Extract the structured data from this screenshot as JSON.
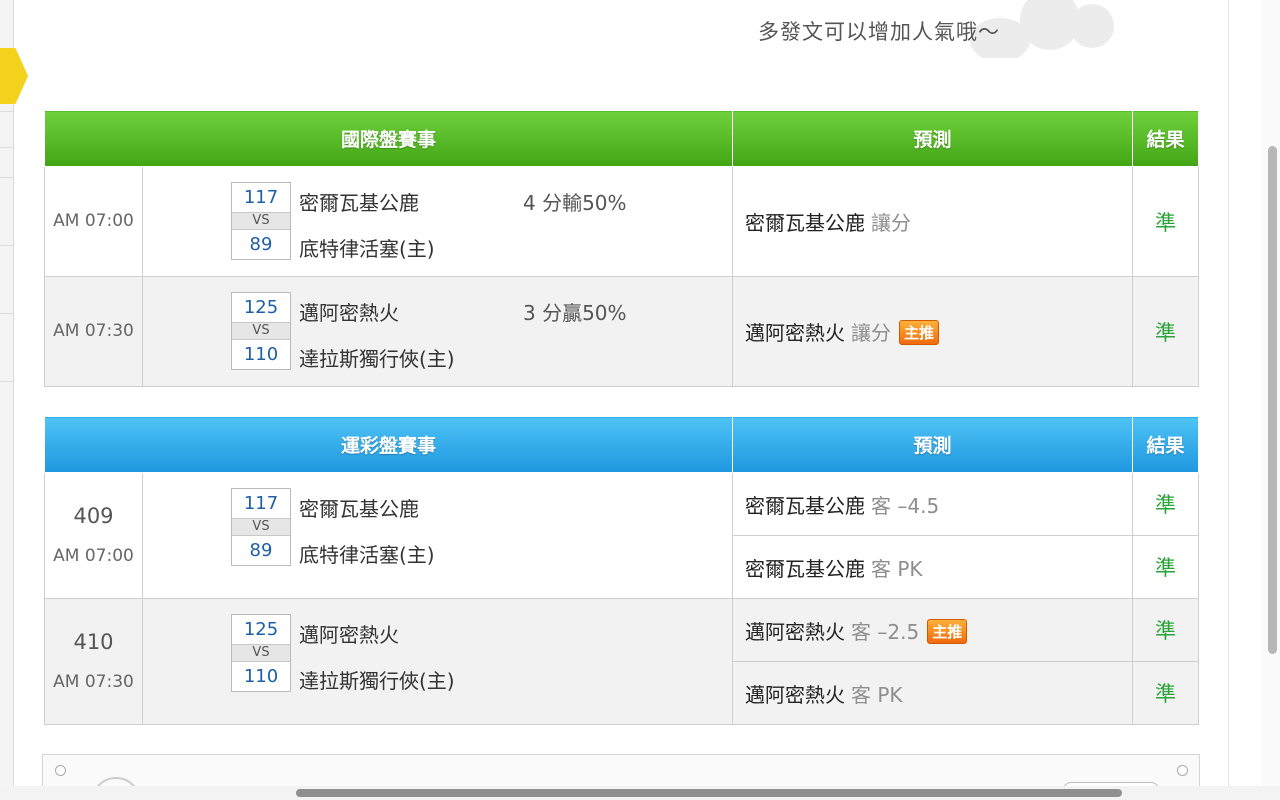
{
  "promo_text": "多發文可以增加人氣哦～",
  "intl": {
    "header": {
      "event": "國際盤賽事",
      "prediction": "預測",
      "result": "結果"
    },
    "rows": [
      {
        "time": "AM 07:00",
        "score_away": "117",
        "vs": "VS",
        "score_home": "89",
        "team_away": "密爾瓦基公鹿",
        "team_home": "底特律活塞(主)",
        "spread": "4 分輸50%",
        "pick_team": "密爾瓦基公鹿",
        "pick_type": "讓分",
        "result": "準"
      },
      {
        "time": "AM 07:30",
        "score_away": "125",
        "vs": "VS",
        "score_home": "110",
        "team_away": "邁阿密熱火",
        "team_home": "達拉斯獨行俠(主)",
        "spread": "3 分贏50%",
        "pick_team": "邁阿密熱火",
        "pick_type": "讓分",
        "badge": "主推",
        "result": "準"
      }
    ]
  },
  "lottery": {
    "header": {
      "event": "運彩盤賽事",
      "prediction": "預測",
      "result": "結果"
    },
    "games": [
      {
        "number": "409",
        "time": "AM 07:00",
        "score_away": "117",
        "vs": "VS",
        "score_home": "89",
        "team_away": "密爾瓦基公鹿",
        "team_home": "底特律活塞(主)",
        "picks": [
          {
            "team": "密爾瓦基公鹿",
            "line": "客 –4.5",
            "result": "準"
          },
          {
            "team": "密爾瓦基公鹿",
            "line": "客 PK",
            "result": "準"
          }
        ]
      },
      {
        "number": "410",
        "time": "AM 07:30",
        "score_away": "125",
        "vs": "VS",
        "score_home": "110",
        "team_away": "邁阿密熱火",
        "team_home": "達拉斯獨行俠(主)",
        "picks": [
          {
            "team": "邁阿密熱火",
            "line": "客 –2.5",
            "badge": "主推",
            "result": "準"
          },
          {
            "team": "邁阿密熱火",
            "line": "客 PK",
            "result": "準"
          }
        ]
      }
    ]
  },
  "colors": {
    "green_header": "#42a514",
    "blue_header": "#1e97e0",
    "result_green": "#2aa33a",
    "badge_orange": "#f06a0d",
    "score_blue": "#1e5fa5"
  }
}
